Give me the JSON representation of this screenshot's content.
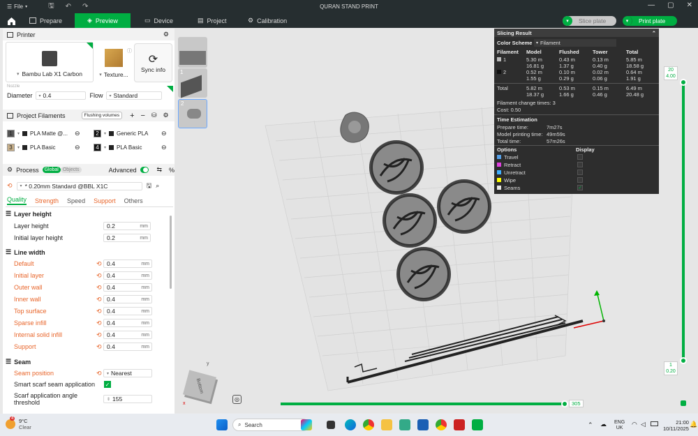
{
  "titlebar": {
    "file_label": "File",
    "title": "QURAN STAND PRINT"
  },
  "nav": {
    "tabs": [
      {
        "label": "Prepare"
      },
      {
        "label": "Preview"
      },
      {
        "label": "Device"
      },
      {
        "label": "Project"
      },
      {
        "label": "Calibration"
      }
    ],
    "slice_plate": "Slice plate",
    "print_plate": "Print plate"
  },
  "printer": {
    "header": "Printer",
    "name": "Bambu Lab X1 Carbon",
    "plate": "Texture...",
    "sync": "Sync info",
    "nozzle_label": "Nozzle",
    "diameter_label": "Diameter",
    "diameter_value": "0.4",
    "flow_label": "Flow",
    "flow_value": "Standard"
  },
  "filaments": {
    "header": "Project Filaments",
    "flushing": "Flushing volumes",
    "items": [
      {
        "num": "1",
        "name": "PLA Matte @...",
        "color": "#555555"
      },
      {
        "num": "2",
        "name": "Generic PLA",
        "color": "#111111"
      },
      {
        "num": "3",
        "name": "PLA Basic",
        "color": "#c8b08a"
      },
      {
        "num": "4",
        "name": "PLA Basic",
        "color": "#111111"
      }
    ]
  },
  "process": {
    "header": "Process",
    "global": "Global",
    "objects": "Objects",
    "advanced": "Advanced",
    "preset": "* 0.20mm Standard @BBL X1C",
    "tabs": [
      "Quality",
      "Strength",
      "Speed",
      "Support",
      "Others"
    ],
    "layer_height_group": "Layer height",
    "layer_height_label": "Layer height",
    "layer_height_value": "0.2",
    "initial_layer_height_label": "Initial layer height",
    "initial_layer_height_value": "0.2",
    "line_width_group": "Line width",
    "line_widths": [
      {
        "label": "Default",
        "value": "0.4"
      },
      {
        "label": "Initial layer",
        "value": "0.4"
      },
      {
        "label": "Outer wall",
        "value": "0.4"
      },
      {
        "label": "Inner wall",
        "value": "0.4"
      },
      {
        "label": "Top surface",
        "value": "0.4"
      },
      {
        "label": "Sparse infill",
        "value": "0.4"
      },
      {
        "label": "Internal solid infill",
        "value": "0.4"
      },
      {
        "label": "Support",
        "value": "0.4"
      }
    ],
    "unit": "mm",
    "seam_group": "Seam",
    "seam_position_label": "Seam position",
    "seam_position_value": "Nearest",
    "smart_scarf_label": "Smart scarf seam application",
    "scarf_angle_label": "Scarf application angle threshold",
    "scarf_angle_value": "155"
  },
  "viewport": {
    "plate_thumbs": [
      "1",
      "2"
    ],
    "layer_top": "20",
    "layer_top_height": "4.00",
    "layer_bottom": "1",
    "layer_bottom_height": "0.20",
    "moves": "305",
    "cube_label": "Bottom",
    "axis_y": "y",
    "axis_x": "x"
  },
  "slicing": {
    "title": "Slicing Result",
    "color_scheme_label": "Color Scheme",
    "color_scheme_value": "Filament",
    "columns": [
      "Filament",
      "Model",
      "Flushed",
      "Tower",
      "Total"
    ],
    "rows": [
      {
        "id": "1",
        "model_m": "5.30 m",
        "model_g": "16.81 g",
        "flushed_m": "0.43 m",
        "flushed_g": "1.37 g",
        "tower_m": "0.13 m",
        "tower_g": "0.40 g",
        "total_m": "5.85 m",
        "total_g": "18.58 g"
      },
      {
        "id": "2",
        "model_m": "0.52 m",
        "model_g": "1.55 g",
        "flushed_m": "0.10 m",
        "flushed_g": "0.29 g",
        "tower_m": "0.02 m",
        "tower_g": "0.06 g",
        "total_m": "0.64 m",
        "total_g": "1.91 g"
      }
    ],
    "total": {
      "label": "Total",
      "model_m": "5.82 m",
      "model_g": "18.37 g",
      "flushed_m": "0.53 m",
      "flushed_g": "1.66 g",
      "tower_m": "0.15 m",
      "tower_g": "0.46 g",
      "total_m": "6.49 m",
      "total_g": "20.48 g"
    },
    "change_times": "Filament change times:  3",
    "cost": "Cost:  0.50",
    "time_estimation": "Time Estimation",
    "prepare_label": "Prepare time:",
    "prepare_value": "7m27s",
    "model_time_label": "Model printing time:",
    "model_time_value": "49m59s",
    "total_time_label": "Total time:",
    "total_time_value": "57m26s",
    "options_label": "Options",
    "display_label": "Display",
    "options": [
      {
        "name": "Travel",
        "color": "#56a0e8"
      },
      {
        "name": "Retract",
        "color": "#e040e0"
      },
      {
        "name": "Unretract",
        "color": "#40b0ff"
      },
      {
        "name": "Wipe",
        "color": "#ffff00"
      },
      {
        "name": "Seams",
        "color": "#e8e8e8"
      }
    ]
  },
  "taskbar": {
    "temp": "9°C",
    "weather": "Clear",
    "search": "Search",
    "lang1": "ENG",
    "lang2": "UK",
    "time": "21:00",
    "date": "10/11/2025",
    "badge": "4"
  },
  "colors": {
    "accent": "#00ae42",
    "orange": "#e8652a",
    "dark": "#262e30"
  }
}
